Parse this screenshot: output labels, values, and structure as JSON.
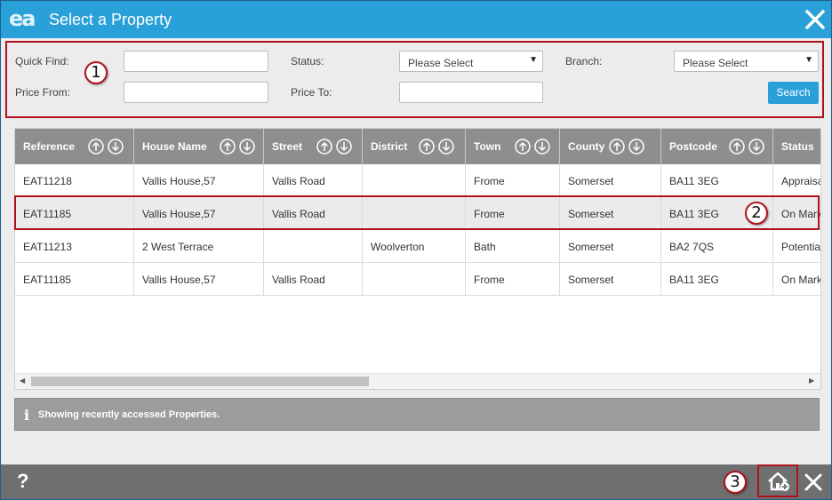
{
  "titlebar": {
    "logo": "ea",
    "title": "Select a Property"
  },
  "filters": {
    "quick_find_label": "Quick Find:",
    "quick_find_value": "",
    "price_from_label": "Price From:",
    "price_from_value": "",
    "status_label": "Status:",
    "status_selected": "Please Select",
    "price_to_label": "Price To:",
    "price_to_value": "",
    "branch_label": "Branch:",
    "branch_selected": "Please Select",
    "search_label": "Search"
  },
  "callouts": {
    "one": "1",
    "two": "2",
    "three": "3"
  },
  "grid": {
    "columns": [
      "Reference",
      "House Name",
      "Street",
      "District",
      "Town",
      "County",
      "Postcode",
      "Status"
    ],
    "rows": [
      [
        "EAT11218",
        "Vallis House,57",
        "Vallis Road",
        "",
        "Frome",
        "Somerset",
        "BA11 3EG",
        "Appraisal"
      ],
      [
        "EAT11185",
        "Vallis House,57",
        "Vallis Road",
        "",
        "Frome",
        "Somerset",
        "BA11 3EG",
        "On Market"
      ],
      [
        "EAT11213",
        "2 West Terrace",
        "",
        "Woolverton",
        "Bath",
        "Somerset",
        "BA2 7QS",
        "Potential"
      ],
      [
        "EAT11185",
        "Vallis House,57",
        "Vallis Road",
        "",
        "Frome",
        "Somerset",
        "BA11 3EG",
        "On Market"
      ]
    ],
    "selected_row": 1
  },
  "info": {
    "text": "Showing recently accessed Properties."
  },
  "footer": {
    "help": "?"
  },
  "colors": {
    "accent": "#2aa0d8",
    "highlight": "#b0121b",
    "header": "#8e8e8e",
    "footer": "#6f6f6f"
  }
}
